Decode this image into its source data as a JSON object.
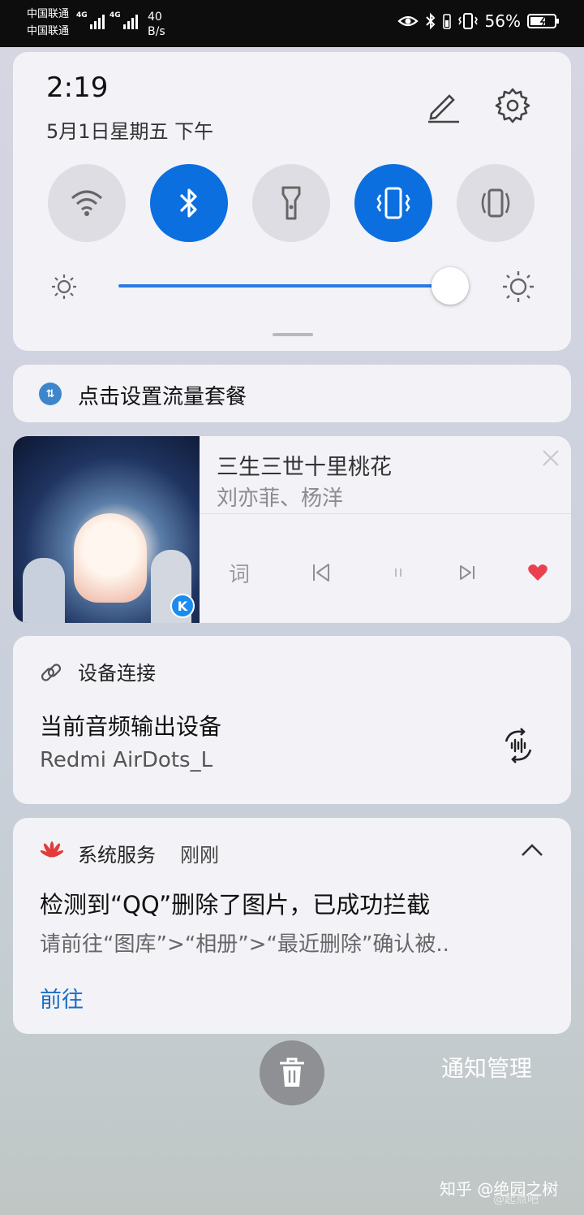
{
  "status_bar": {
    "carrier1": "中国联通",
    "carrier2": "中国联通",
    "net1": "4G",
    "net2": "4G",
    "speed_value": "40",
    "speed_unit": "B/s",
    "battery": "56%",
    "icons": [
      "eye-icon",
      "bluetooth-icon",
      "vibrate-icon",
      "battery-icon"
    ]
  },
  "quick_settings": {
    "time": "2:19",
    "date": "5月1日星期五 下午",
    "toggles": [
      {
        "name": "wifi",
        "icon": "wifi-icon",
        "active": false
      },
      {
        "name": "bluetooth",
        "icon": "bluetooth-icon",
        "active": true
      },
      {
        "name": "flashlight",
        "icon": "flashlight-icon",
        "active": false
      },
      {
        "name": "vibrate",
        "icon": "vibrate-icon",
        "active": true
      },
      {
        "name": "auto-rotate",
        "icon": "rotate-icon",
        "active": false
      }
    ],
    "brightness_level": 0.95,
    "colors": {
      "accent": "#0b6fe0",
      "inactive": "#dedde3"
    }
  },
  "data_plan": {
    "icon": "data-plan-icon",
    "text": "点击设置流量套餐"
  },
  "music": {
    "title": "三生三世十里桃花",
    "artist": "刘亦菲、杨洋",
    "lyrics_label": "词",
    "liked": true,
    "like_color": "#e9414f"
  },
  "device": {
    "header": "设备连接",
    "title": "当前音频输出设备",
    "name": "Redmi AirDots_L"
  },
  "system_notification": {
    "app": "系统服务",
    "time": "刚刚",
    "title": "检测到“QQ”删除了图片，已成功拦截",
    "body": "请前往“图库”>“相册”>“最近删除”确认被..",
    "action": "前往"
  },
  "footer": {
    "manage": "通知管理",
    "watermark": "知乎 @绝园之树",
    "watermark_small": "@起点吧"
  }
}
